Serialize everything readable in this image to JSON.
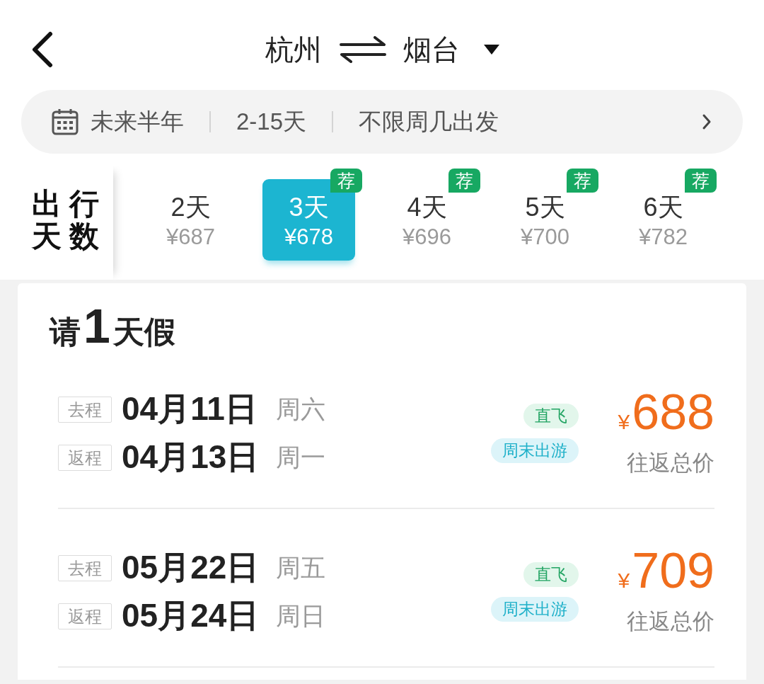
{
  "header": {
    "origin": "杭州",
    "destination": "烟台"
  },
  "filters": [
    "未来半年",
    "2-15天",
    "不限周几出发"
  ],
  "trip_days": {
    "label": "出行天数",
    "options": [
      {
        "day": "2天",
        "price": "¥687",
        "selected": false
      },
      {
        "day": "3天",
        "price": "¥678",
        "selected": true,
        "badge": "荐"
      },
      {
        "day": "4天",
        "price": "¥696",
        "selected": false,
        "badge": "荐"
      },
      {
        "day": "5天",
        "price": "¥700",
        "selected": false,
        "badge": "荐"
      },
      {
        "day": "6天",
        "price": "¥782",
        "selected": false,
        "badge": "荐"
      }
    ]
  },
  "leave_group": {
    "heading": {
      "prefix": "请",
      "days": "1",
      "suffix": "天假"
    },
    "trips": [
      {
        "legs": [
          {
            "label": "去程",
            "date": "04月11日",
            "weekday": "周六"
          },
          {
            "label": "返程",
            "date": "04月13日",
            "weekday": "周一"
          }
        ],
        "tags": [
          {
            "kind": "direct",
            "text": "直飞"
          },
          {
            "kind": "weekend",
            "text": "周末出游"
          }
        ],
        "currency": "¥",
        "price": "688",
        "price_note": "往返总价"
      },
      {
        "legs": [
          {
            "label": "去程",
            "date": "05月22日",
            "weekday": "周五"
          },
          {
            "label": "返程",
            "date": "05月24日",
            "weekday": "周日"
          }
        ],
        "tags": [
          {
            "kind": "direct",
            "text": "直飞"
          },
          {
            "kind": "weekend",
            "text": "周末出游"
          }
        ],
        "currency": "¥",
        "price": "709",
        "price_note": "往返总价"
      }
    ]
  }
}
